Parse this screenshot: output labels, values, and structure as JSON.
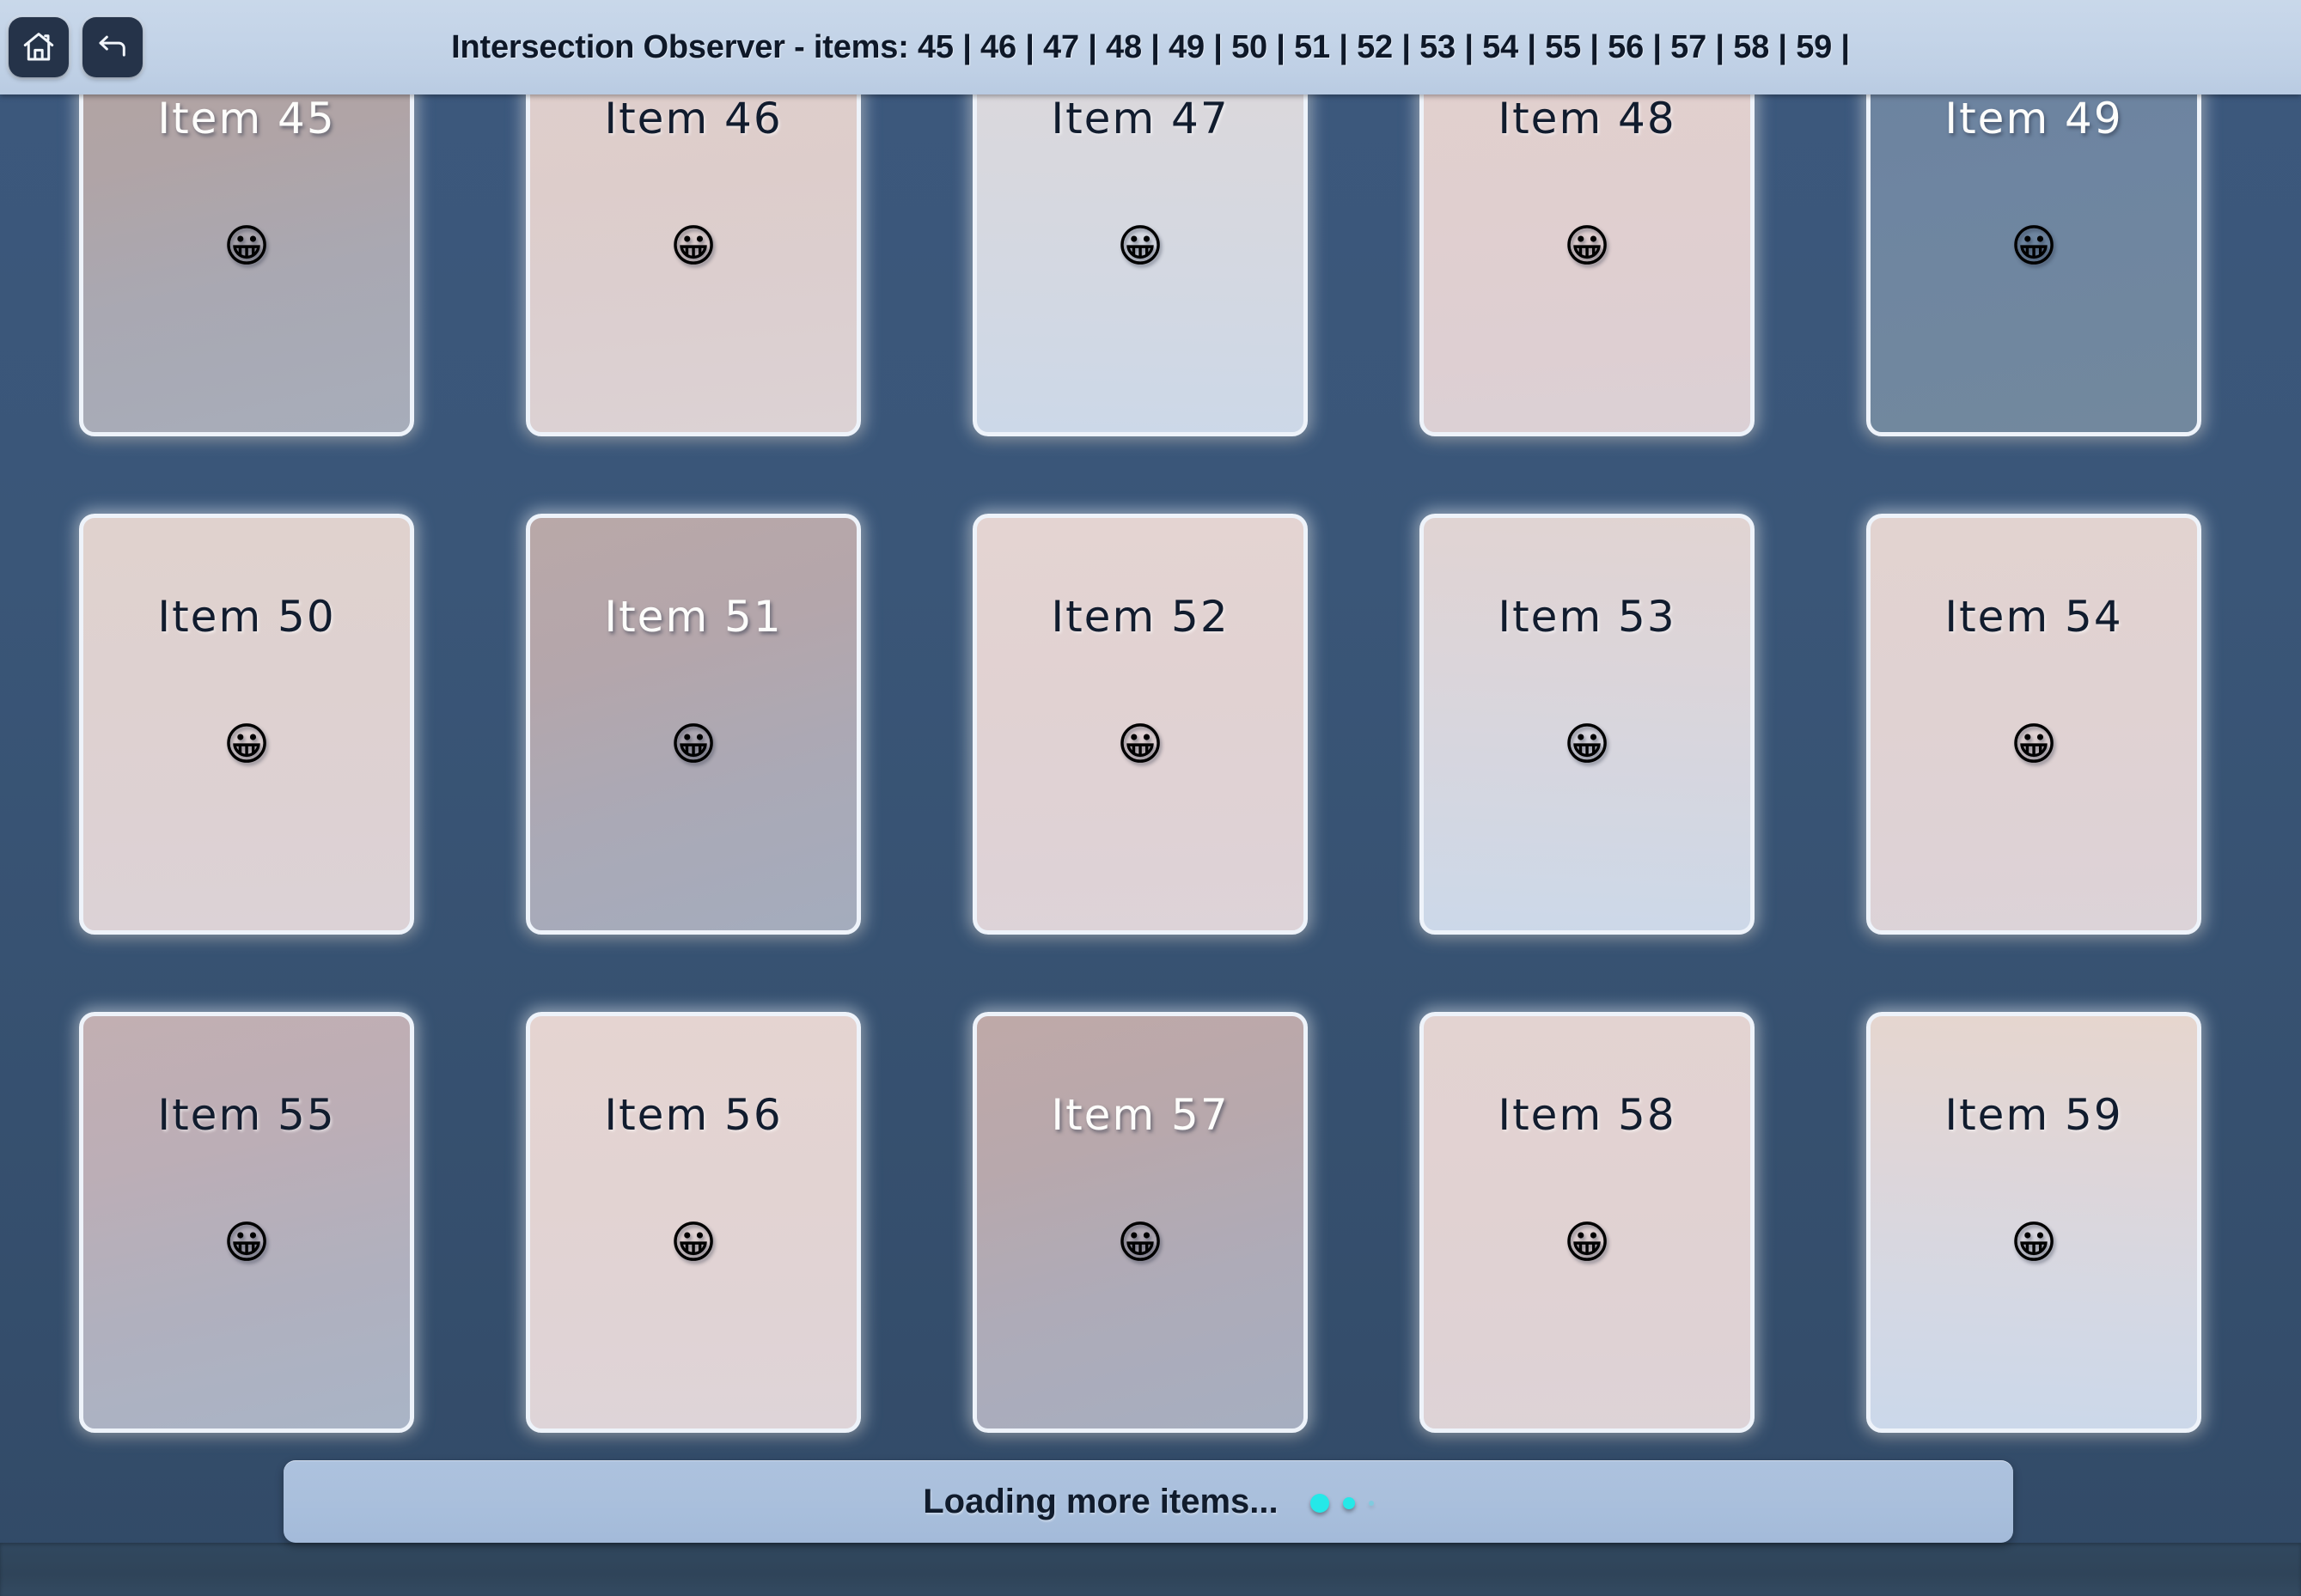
{
  "colors": {
    "page_background": "#35506f",
    "topbar_background": "#c4d4e8",
    "topbar_button": "#253349",
    "card_border": "#eef3fa",
    "loading_strip": "#a9bfdc",
    "loading_dot": "#25e8e8",
    "text_dark": "#111c2e",
    "text_light": "#fdfdfb"
  },
  "topbar": {
    "home_button_label": "home-icon",
    "back_button_label": "back-arrow-icon",
    "title_strong": "Intersection Observer -",
    "title_items": "items: 45 | 46 | 47 | 48 | 49 | 50 | 51 | 52 | 53 | 54 | 55 | 56 | 57 | 58 | 59 |",
    "title_full": "Intersection Observer -  items: 45 | 46 | 47 | 48 | 49 | 50 | 51 | 52 | 53 | 54 | 55 | 56 | 57 | 58 | 59 |"
  },
  "observed_item_ids": [
    45,
    46,
    47,
    48,
    49,
    50,
    51,
    52,
    53,
    54,
    55,
    56,
    57,
    58,
    59
  ],
  "grid": {
    "columns": 5,
    "rows": 3,
    "cards": [
      {
        "label": "Item 45",
        "emoji": "😀",
        "emoji_name": "grinning-face",
        "text_tone": "light",
        "gradient": "linear-gradient(168deg, #b3a3a1 0%, #b0a4a6 32%, #a9a8b2 62%, #a7adba 100%)"
      },
      {
        "label": "Item 46",
        "emoji": "😀",
        "emoji_name": "grinning-face",
        "text_tone": "dark",
        "gradient": "linear-gradient(175deg, #e0cfcc 0%, #ddcdcb 40%, #dccfd0 72%, #dcd2d4 100%)"
      },
      {
        "label": "Item 47",
        "emoji": "😀",
        "emoji_name": "grinning-face",
        "text_tone": "dark",
        "gradient": "linear-gradient(182deg, #ddd7da 0%, #d8d8de 35%, #d2d8e3 70%, #ccd8e8 100%)"
      },
      {
        "label": "Item 48",
        "emoji": "😀",
        "emoji_name": "grinning-face",
        "text_tone": "dark",
        "gradient": "linear-gradient(176deg, #e2d0cd 0%, #e0cfcf 45%, #decfd2 78%, #dbd0d5 100%)"
      },
      {
        "label": "Item 49",
        "emoji": "😀",
        "emoji_name": "grinning-face",
        "text_tone": "light",
        "gradient": "linear-gradient(170deg, #6b829f 0%, #6e85a1 40%, #70879f 72%, #72889e 100%)"
      },
      {
        "label": "Item 50",
        "emoji": "😀",
        "emoji_name": "grinning-face",
        "text_tone": "dark",
        "gradient": "linear-gradient(178deg, #e0d2ce 0%, #ded1d0 40%, #ddd1d3 74%, #dcd2d6 100%)"
      },
      {
        "label": "Item 51",
        "emoji": "😀",
        "emoji_name": "grinning-face",
        "text_tone": "light",
        "gradient": "linear-gradient(165deg, #b9a8a8 0%, #b4a6ab 33%, #aaa9b6 66%, #a4acbd 100%)"
      },
      {
        "label": "Item 52",
        "emoji": "😀",
        "emoji_name": "grinning-face",
        "text_tone": "dark",
        "gradient": "linear-gradient(178deg, #e4d4d2 0%, #e1d2d2 42%, #dfd2d5 76%, #ddd3d8 100%)"
      },
      {
        "label": "Item 53",
        "emoji": "😀",
        "emoji_name": "grinning-face",
        "text_tone": "dark",
        "gradient": "linear-gradient(183deg, #e1d4d2 0%, #dbd5da 38%, #d3d7e2 72%, #ccd8e9 100%)"
      },
      {
        "label": "Item 54",
        "emoji": "😀",
        "emoji_name": "grinning-face",
        "text_tone": "dark",
        "gradient": "linear-gradient(177deg, #e2d3d0 0%, #e0d2d2 45%, #ded2d5 78%, #dcd3d8 100%)"
      },
      {
        "label": "Item 55",
        "emoji": "😀",
        "emoji_name": "grinning-face",
        "text_tone": "dark",
        "gradient": "linear-gradient(168deg, #c2afb2 0%, #bcaeb6 33%, #b0b0be 66%, #a9b4c6 100%)"
      },
      {
        "label": "Item 56",
        "emoji": "😀",
        "emoji_name": "grinning-face",
        "text_tone": "dark",
        "gradient": "linear-gradient(178deg, #e5d4d1 0%, #e2d3d2 42%, #e0d3d5 76%, #ded4d8 100%)"
      },
      {
        "label": "Item 57",
        "emoji": "😀",
        "emoji_name": "grinning-face",
        "text_tone": "light",
        "gradient": "linear-gradient(166deg, #bfa9a8 0%, #b8a8ac 32%, #aeabb8 64%, #a6aec0 100%)"
      },
      {
        "label": "Item 58",
        "emoji": "😀",
        "emoji_name": "grinning-face",
        "text_tone": "dark",
        "gradient": "linear-gradient(178deg, #e3d3d1 0%, #e1d2d2 44%, #dfd2d4 77%, #ddd3d7 100%)"
      },
      {
        "label": "Item 59",
        "emoji": "😀",
        "emoji_name": "grinning-face",
        "text_tone": "dark",
        "gradient": "linear-gradient(183deg, #e6d6ce 0%, #ded6d9 36%, #d4d8e4 70%, #cbd8ea 100%)"
      }
    ]
  },
  "loading": {
    "text": "Loading more items...",
    "dot_count": 3
  }
}
